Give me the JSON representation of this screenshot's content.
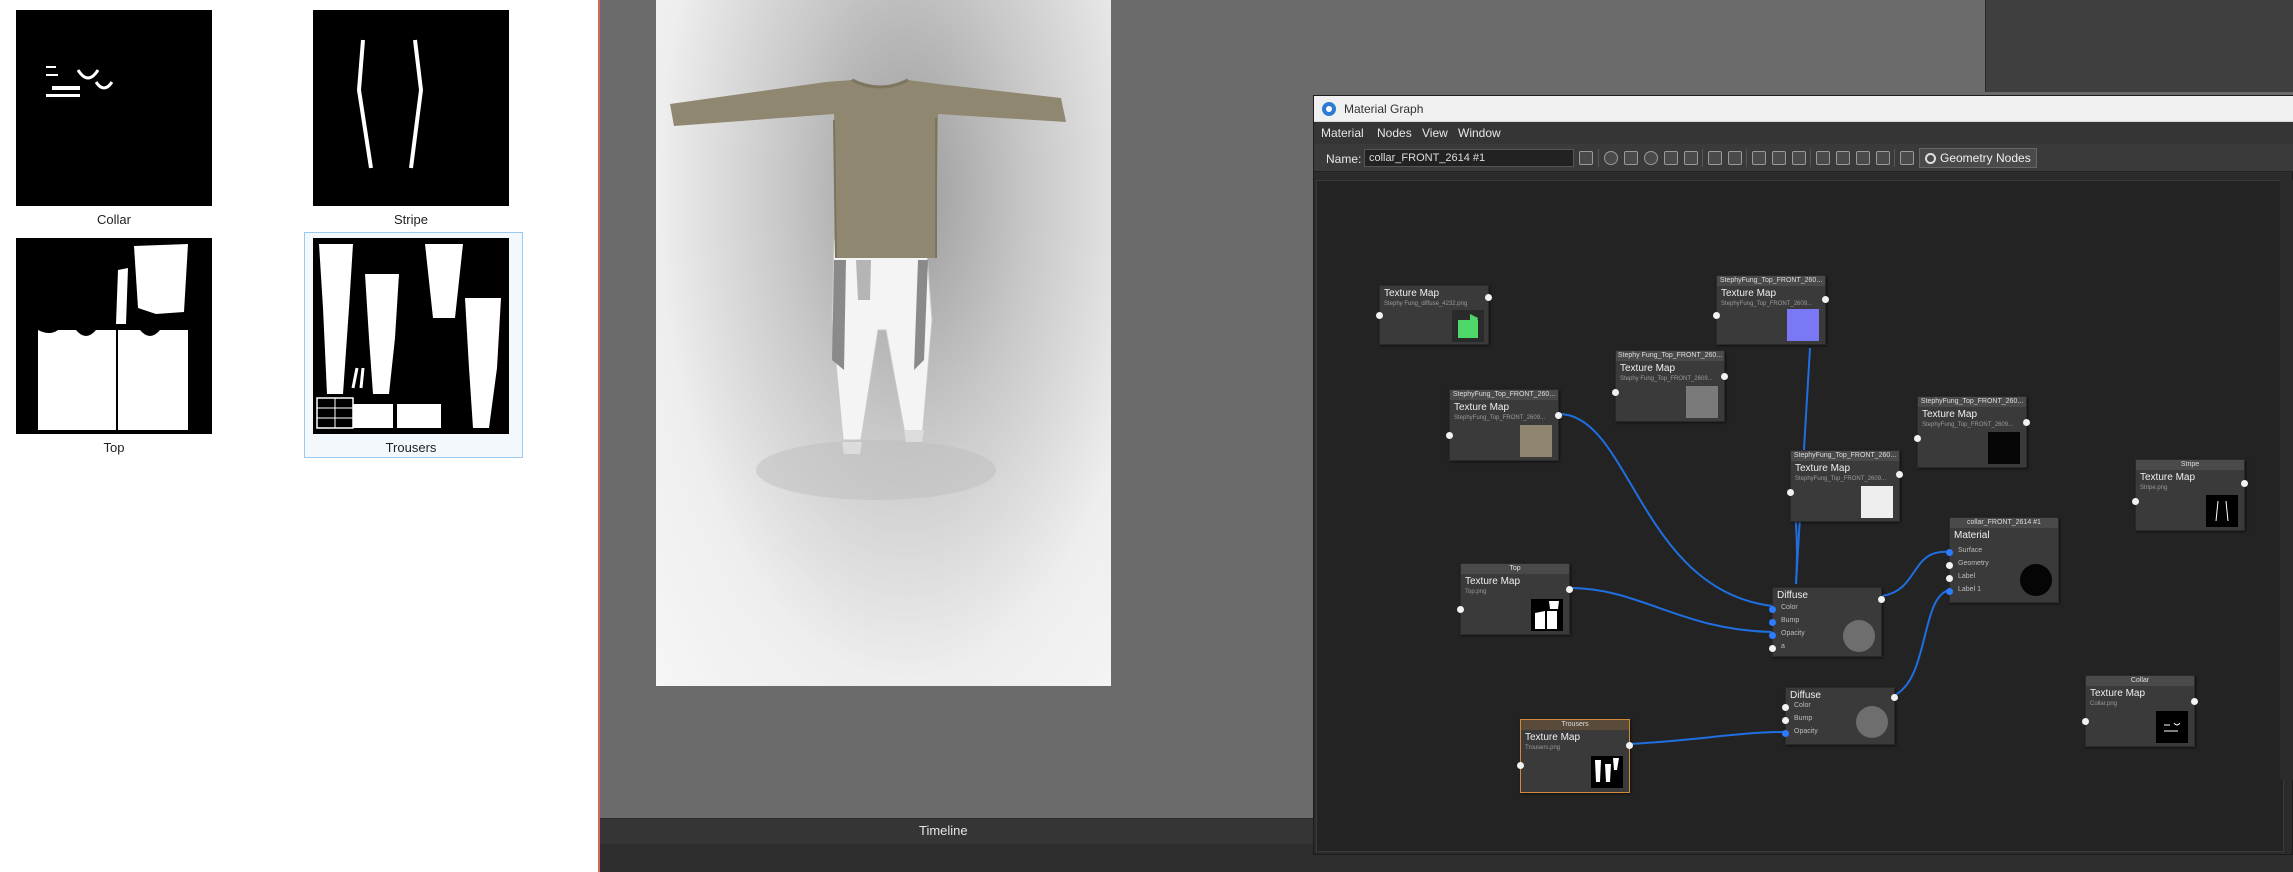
{
  "textures": [
    {
      "label": "Collar"
    },
    {
      "label": "Stripe"
    },
    {
      "label": "Top"
    },
    {
      "label": "Trousers"
    }
  ],
  "timeline": {
    "label": "Timeline"
  },
  "material_graph": {
    "title": "Material Graph",
    "menu": [
      "Material",
      "Nodes",
      "View",
      "Window"
    ],
    "name_label": "Name:",
    "name_value": "collar_FRONT_2614 #1",
    "geometry_nodes_label": "Geometry Nodes",
    "nodes": {
      "tm_diffuse": {
        "title": "Texture Map",
        "sub": "Stephy Fung_diffuse_4232.png"
      },
      "tm_normal": {
        "header": "StephyFung_Top_FRONT_260...",
        "title": "Texture Map",
        "sub": "StephyFung_Top_FRONT_2609..."
      },
      "tm_gray": {
        "header": "Stephy Fung_Top_FRONT_260...",
        "title": "Texture Map",
        "sub": "Stephy Fung_Top_FRONT_2609..."
      },
      "tm_fabric": {
        "header": "StephyFung_Top_FRONT_260...",
        "title": "Texture Map",
        "sub": "StephyFung_Top_FRONT_2609..."
      },
      "tm_black": {
        "header": "StephyFung_Top_FRONT_260...",
        "title": "Texture Map",
        "sub": "StephyFung_Top_FRONT_2609..."
      },
      "tm_white": {
        "header": "StephyFung_Top_FRONT_260...",
        "title": "Texture Map",
        "sub": "StephyFung_Top_FRONT_2609..."
      },
      "tm_stripe": {
        "header": "Stripe",
        "title": "Texture Map",
        "sub": "Stripe.png"
      },
      "material": {
        "header": "collar_FRONT_2614 #1",
        "title": "Material",
        "ports": [
          "Surface",
          "Geometry",
          "Label",
          "Label 1"
        ]
      },
      "tm_top": {
        "header": "Top",
        "title": "Texture Map",
        "sub": "Top.png"
      },
      "diffuse1": {
        "title": "Diffuse",
        "ports": [
          "Color",
          "Bump",
          "Opacity",
          "a"
        ]
      },
      "diffuse2": {
        "title": "Diffuse",
        "ports": [
          "Color",
          "Bump",
          "Opacity"
        ]
      },
      "tm_collar": {
        "header": "Collar",
        "title": "Texture Map",
        "sub": "Collar.png"
      },
      "tm_trousers": {
        "header": "Trousers",
        "title": "Texture Map",
        "sub": "Trousers.png"
      }
    }
  },
  "colors": {
    "wire": "#1f6fe0",
    "selection": "#d08a3c",
    "accent": "#2d7bd4"
  }
}
